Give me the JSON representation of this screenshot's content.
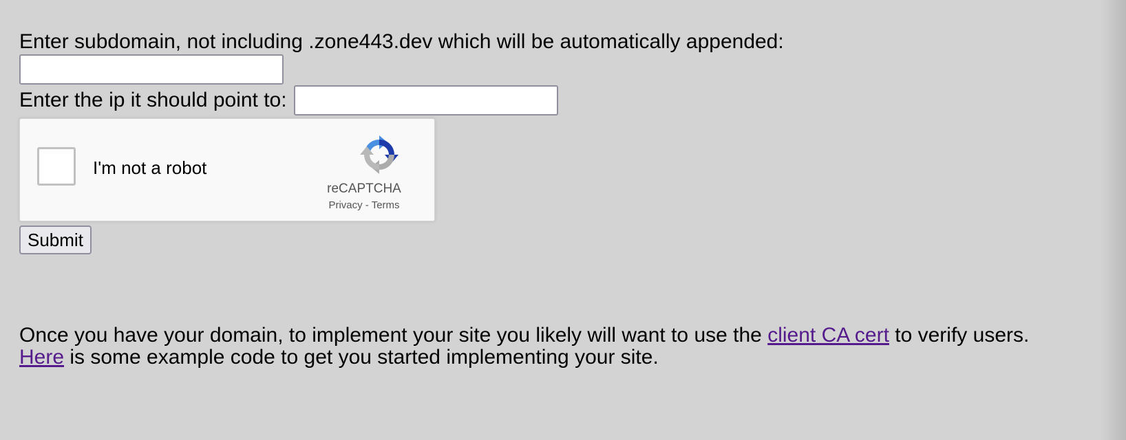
{
  "form": {
    "subdomain_prompt": "Enter subdomain, not including .zone443.dev which will be automatically appended:",
    "subdomain_value": "",
    "ip_prompt": "Enter the ip it should point to:",
    "ip_value": "",
    "submit_label": "Submit"
  },
  "recaptcha": {
    "label": "I'm not a robot",
    "brand": "reCAPTCHA",
    "privacy": "Privacy",
    "separator": " - ",
    "terms": "Terms",
    "icon": "recaptcha-logo-icon"
  },
  "info": {
    "line1_before": "Once you have your domain, to implement your site you likely will want to use the ",
    "line1_link": "client CA cert",
    "line1_after": " to verify users.",
    "line2_link": "Here",
    "line2_after": " is some example code to get you started implementing your site."
  },
  "colors": {
    "page_background": "#d3d3d3",
    "visited_link": "#551a8b",
    "recaptcha_background": "#f9f9f9"
  }
}
